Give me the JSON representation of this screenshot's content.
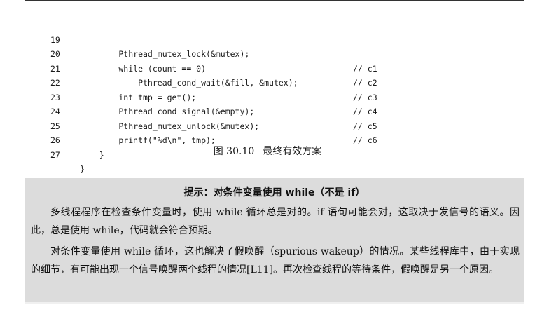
{
  "code": {
    "lines": [
      {
        "no": "19",
        "code": "        Pthread_mutex_lock(&mutex);",
        "comment": "// c1"
      },
      {
        "no": "20",
        "code": "        while (count == 0)",
        "comment": "// c2"
      },
      {
        "no": "21",
        "code": "            Pthread_cond_wait(&fill, &mutex);",
        "comment": "// c3"
      },
      {
        "no": "22",
        "code": "        int tmp = get();",
        "comment": "// c4"
      },
      {
        "no": "23",
        "code": "        Pthread_cond_signal(&empty);",
        "comment": "// c5"
      },
      {
        "no": "24",
        "code": "        Pthread_mutex_unlock(&mutex);",
        "comment": "// c6"
      },
      {
        "no": "25",
        "code": "        printf(\"%d\\n\", tmp);",
        "comment": ""
      },
      {
        "no": "26",
        "code": "    }",
        "comment": ""
      },
      {
        "no": "27",
        "code": "}",
        "comment": ""
      }
    ]
  },
  "caption": {
    "figure_number": "图 30.10",
    "title": "最终有效方案"
  },
  "note": {
    "title": "提示：对条件变量使用 while（不是 if）",
    "paragraph_1": "多线程程序在检查条件变量时，使用 while 循环总是对的。if 语句可能会对，这取决于发信号的语义。因此，总是使用 while，代码就会符合预期。",
    "paragraph_2": "对条件变量使用 while 循环，这也解决了假唤醒（spurious wakeup）的情况。某些线程库中，由于实现的细节，有可能出现一个信号唤醒两个线程的情况[L11]。再次检查线程的等待条件，假唤醒是另一个原因。"
  }
}
